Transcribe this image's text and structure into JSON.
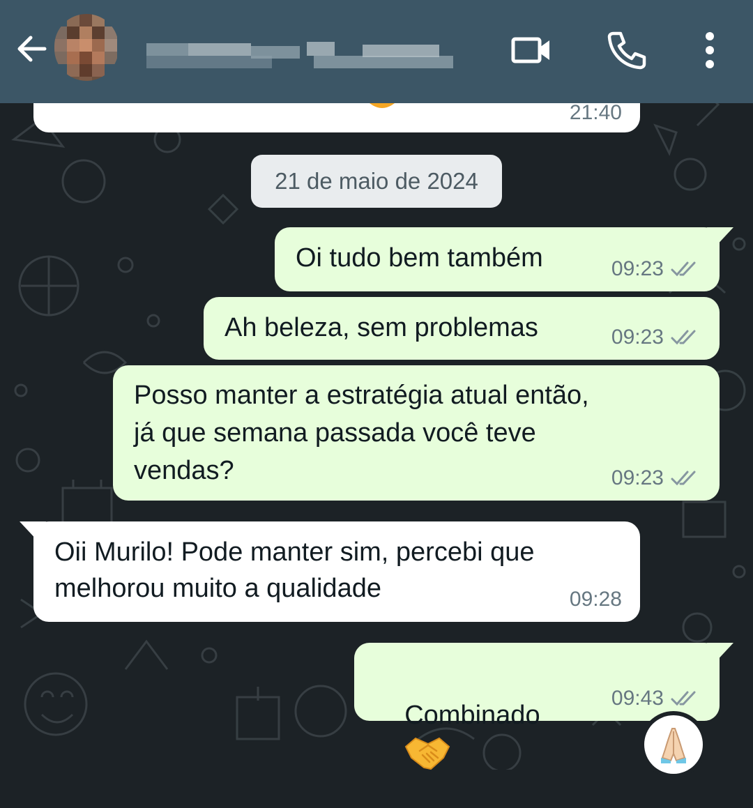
{
  "header": {
    "contact_name": "",
    "icons": [
      "back-arrow-icon",
      "video-call-icon",
      "voice-call-icon",
      "more-options-icon"
    ]
  },
  "date_separator": "21 de maio de 2024",
  "previous_message": {
    "time": "21:40"
  },
  "messages": [
    {
      "direction": "outgoing",
      "text": "Oi tudo bem também",
      "time": "09:23",
      "status": "read"
    },
    {
      "direction": "outgoing",
      "text": "Ah beleza, sem problemas",
      "time": "09:23",
      "status": "read"
    },
    {
      "direction": "outgoing",
      "text": "Posso manter a estratégia atual então,\njá que semana passada você teve\nvendas?",
      "time": "09:23",
      "status": "read"
    },
    {
      "direction": "incoming",
      "text": "Oii Murilo! Pode manter sim, percebi que\nmelhorou muito a qualidade",
      "time": "09:28"
    },
    {
      "direction": "outgoing",
      "text": "Combinado",
      "emoji": "handshake",
      "time": "09:43",
      "status": "read",
      "reaction": "folded-hands"
    }
  ],
  "colors": {
    "header": "#3c5666",
    "background": "#1c2226",
    "outgoing_bubble": "#e7fedb",
    "incoming_bubble": "#ffffff",
    "timestamp": "#667781"
  }
}
